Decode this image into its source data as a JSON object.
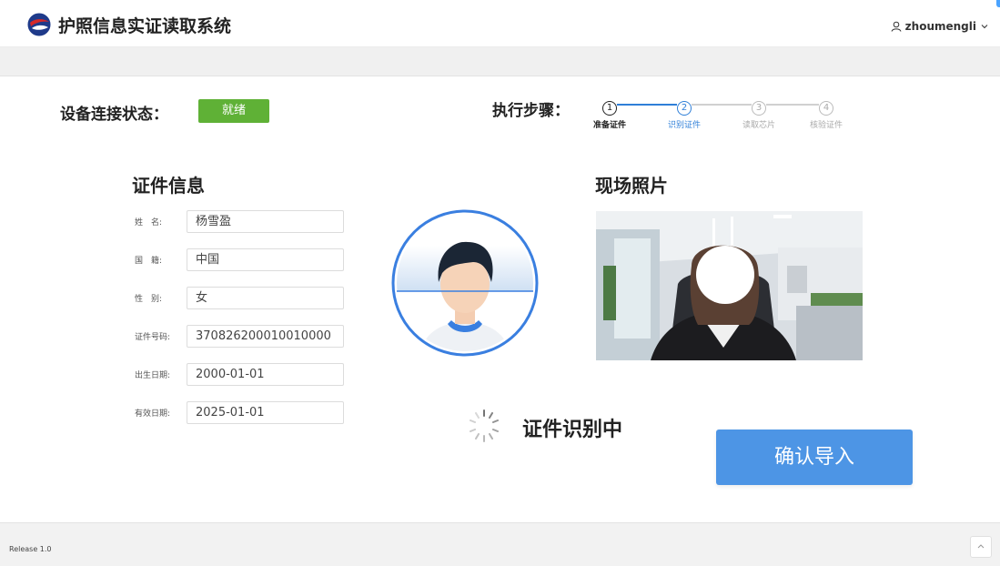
{
  "header": {
    "title": "护照信息实证读取系统",
    "username": "zhoumengli"
  },
  "device": {
    "label": "设备连接状态：",
    "status": "就绪",
    "status_color": "#5fb136"
  },
  "steps": {
    "label": "执行步骤：",
    "items": [
      {
        "num": "1",
        "label": "准备证件",
        "state": "done"
      },
      {
        "num": "2",
        "label": "识别证件",
        "state": "active"
      },
      {
        "num": "3",
        "label": "读取芯片",
        "state": "todo"
      },
      {
        "num": "4",
        "label": "核验证件",
        "state": "todo"
      }
    ]
  },
  "id_info": {
    "title": "证件信息",
    "fields": [
      {
        "label": "姓　名:",
        "value": "杨雪盈"
      },
      {
        "label": "国　籍:",
        "value": "中国"
      },
      {
        "label": "性　别:",
        "value": "女"
      },
      {
        "label": "证件号码:",
        "value": "370826200010010000"
      },
      {
        "label": "出生日期:",
        "value": "2000-01-01"
      },
      {
        "label": "有效日期:",
        "value": "2025-01-01"
      }
    ]
  },
  "photo": {
    "title": "现场照片"
  },
  "recognition": {
    "text": "证件识别中"
  },
  "actions": {
    "confirm_label": "确认导入",
    "accent": "#4d95e5"
  },
  "footer": {
    "release": "Release 1.0"
  }
}
